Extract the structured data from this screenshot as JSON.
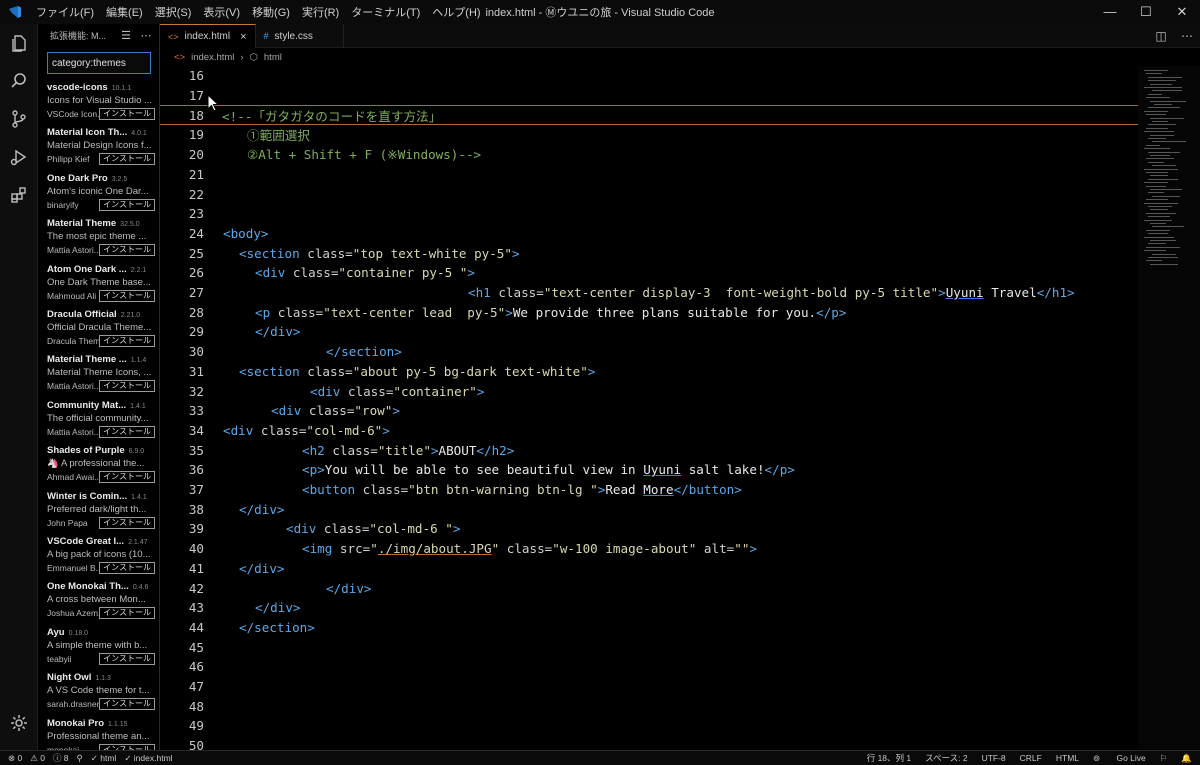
{
  "window": {
    "title": "index.html - Ⓜウユニの旅 - Visual Studio Code",
    "menu": [
      "ファイル(F)",
      "編集(E)",
      "選択(S)",
      "表示(V)",
      "移動(G)",
      "実行(R)",
      "ターミナル(T)",
      "ヘルプ(H)"
    ],
    "controls": [
      "—",
      "☐",
      "✕"
    ]
  },
  "activity_icons": [
    "files-icon",
    "search-icon",
    "source-control-icon",
    "run-debug-icon",
    "extensions-icon"
  ],
  "sidebar": {
    "title": "拡張機能: M...",
    "search_value": "category:themes",
    "extensions": [
      {
        "name": "vscode-icons",
        "version": "10.1.1",
        "desc": "Icons for Visual Studio ...",
        "author": "VSCode Icon...",
        "button": "インストール"
      },
      {
        "name": "Material Icon Th...",
        "version": "4.0.1",
        "desc": "Material Design Icons f...",
        "author": "Philipp Kief",
        "button": "インストール"
      },
      {
        "name": "One Dark Pro",
        "version": "3.2.5",
        "desc": "Atom's iconic One Dar...",
        "author": "binaryify",
        "button": "インストール"
      },
      {
        "name": "Material Theme",
        "version": "32.5.0",
        "desc": "The most epic theme ...",
        "author": "Mattia Astori...",
        "button": "インストール"
      },
      {
        "name": "Atom One Dark ...",
        "version": "2.2.1",
        "desc": "One Dark Theme base...",
        "author": "Mahmoud Ali",
        "button": "インストール"
      },
      {
        "name": "Dracula Official",
        "version": "2.21.0",
        "desc": "Official Dracula Theme...",
        "author": "Dracula Theme",
        "button": "インストール"
      },
      {
        "name": "Material Theme ...",
        "version": "1.1.4",
        "desc": "Material Theme Icons, ...",
        "author": "Mattia Astori...",
        "button": "インストール"
      },
      {
        "name": "Community Mat...",
        "version": "1.4.1",
        "desc": "The official community...",
        "author": "Mattia Astori...",
        "button": "インストール"
      },
      {
        "name": "Shades of Purple",
        "version": "6.9.0",
        "desc": "🦄 A professional the...",
        "author": "Ahmad Awai...",
        "button": "インストール"
      },
      {
        "name": "Winter is Comin...",
        "version": "1.4.1",
        "desc": "Preferred dark/light th...",
        "author": "John Papa",
        "button": "インストール"
      },
      {
        "name": "VSCode Great I...",
        "version": "2.1.47",
        "desc": "A big pack of icons (10...",
        "author": "Emmanuel B...",
        "button": "インストール"
      },
      {
        "name": "One Monokai Th...",
        "version": "0.4.6",
        "desc": "A cross between Mon...",
        "author": "Joshua Azem...",
        "button": "インストール"
      },
      {
        "name": "Ayu",
        "version": "0.18.0",
        "desc": "A simple theme with b...",
        "author": "teabyii",
        "button": "インストール"
      },
      {
        "name": "Night Owl",
        "version": "1.1.3",
        "desc": "A VS Code theme for t...",
        "author": "sarah.drasner",
        "button": "インストール"
      },
      {
        "name": "Monokai Pro",
        "version": "1.1.15",
        "desc": "Professional theme an...",
        "author": "monokai",
        "button": "インストール"
      }
    ]
  },
  "tabs": [
    {
      "label": "index.html",
      "icon": "<>"
    },
    {
      "label": "style.css",
      "icon": "#"
    }
  ],
  "breadcrumb": [
    "index.html",
    "html"
  ],
  "editor": {
    "line_numbers": [
      "16",
      "17",
      "18",
      "19",
      "20",
      "21",
      "22",
      "23",
      "24",
      "25",
      "26",
      "27",
      "28",
      "29",
      "30",
      "31",
      "32",
      "33",
      "34",
      "35",
      "36",
      "37",
      "38",
      "39",
      "40",
      "41",
      "42",
      "43",
      "44",
      "45",
      "46",
      "47",
      "48",
      "49",
      "50"
    ],
    "comment": {
      "l18": "<!--「ガタガタのコードを直す方法」",
      "l19": "①範囲選択",
      "l20": "②Alt + Shift + F (※Windows)-->"
    },
    "code": {
      "l24_tag": "<body>",
      "l25_open": "<section",
      "l25_attr": " class=",
      "l25_val": "\"top text-white py-5\"",
      "l25_close": ">",
      "l26_open": "<div",
      "l26_attr": " class=",
      "l26_val": "\"container py-5 \"",
      "l26_close": ">",
      "l27_open": "<h1",
      "l27_attr": " class=",
      "l27_val": "\"text-center display-3  font-weight-bold py-5 title\"",
      "l27_close": ">",
      "l27_text_a": "Uyuni",
      "l27_text_b": " Travel",
      "l27_end": "</h1>",
      "l28_open": "<p",
      "l28_attr": " class=",
      "l28_val": "\"text-center lead  py-5\"",
      "l28_close": ">",
      "l28_text": "We provide three plans suitable for you.",
      "l28_end": "</p>",
      "l29_tag": "</div>",
      "l30_tag": "</section>",
      "l31_open": "<section",
      "l31_attr": " class=",
      "l31_val": "\"about py-5 bg-dark text-white\"",
      "l31_close": ">",
      "l32_open": "<div",
      "l32_attr": " class=",
      "l32_val": "\"container\"",
      "l32_close": ">",
      "l33_open": "<div",
      "l33_attr": " class=",
      "l33_val": "\"row\"",
      "l33_close": ">",
      "l34_open": "<div",
      "l34_attr": " class=",
      "l34_val": "\"col-md-6\"",
      "l34_close": ">",
      "l35_open": "<h2",
      "l35_attr": " class=",
      "l35_val": "\"title\"",
      "l35_close": ">",
      "l35_text": "ABOUT",
      "l35_end": "</h2>",
      "l36_open": "<p>",
      "l36_text_a": "You will be able to see beautiful view in ",
      "l36_text_b": "Uyuni",
      "l36_text_c": " salt lake!",
      "l36_end": "</p>",
      "l37_open": "<button",
      "l37_attr": " class=",
      "l37_val": "\"btn btn-warning btn-lg \"",
      "l37_close": ">",
      "l37_text_a": "Read ",
      "l37_text_b": "More",
      "l37_end": "</button>",
      "l38_tag": "</div>",
      "l39_open": "<div",
      "l39_attr": " class=",
      "l39_val": "\"col-md-6 \"",
      "l39_close": ">",
      "l40_open": "<img",
      "l40_attr1": " src=",
      "l40_q1": "\"",
      "l40_src": "./img/about.JPG",
      "l40_q2": "\"",
      "l40_attr2": " class=",
      "l40_val2": "\"w-100 image-about\"",
      "l40_attr3": " alt=",
      "l40_val3": "\"\"",
      "l40_close": ">",
      "l41_tag": "</div>",
      "l42_tag": "</div>",
      "l43_tag": "</div>",
      "l44_tag": "</section>"
    }
  },
  "statusbar": {
    "errors": "⊗ 0",
    "warnings": "⚠ 0",
    "info": "ⓘ 8",
    "html_check": "✓ html",
    "file_check": "✓ index.html",
    "position": "行 18、列 1",
    "spaces": "スペース: 2",
    "encoding": "UTF-8",
    "eol": "CRLF",
    "language": "HTML",
    "golive": "Go Live"
  }
}
